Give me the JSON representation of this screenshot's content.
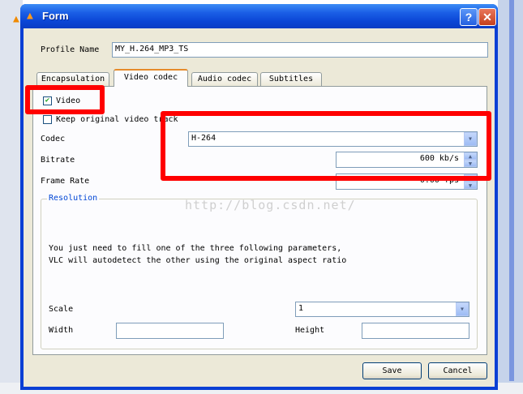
{
  "window": {
    "title": "Form",
    "help_label": "?",
    "close_label": "✕"
  },
  "profile": {
    "label": "Profile Name",
    "value": "MY_H.264_MP3_TS"
  },
  "tabs": [
    {
      "label": "Encapsulation"
    },
    {
      "label": "Video codec"
    },
    {
      "label": "Audio codec"
    },
    {
      "label": "Subtitles"
    }
  ],
  "video_codec": {
    "video_checkbox_label": "Video",
    "keep_original_label": "Keep original video track",
    "codec_label": "Codec",
    "codec_value": "H-264",
    "bitrate_label": "Bitrate",
    "bitrate_value": "600 kb/s",
    "framerate_label": "Frame Rate",
    "framerate_value": "0.00 fps",
    "resolution_title": "Resolution",
    "info_line1": "You just need to fill one of the three following parameters,",
    "info_line2": "VLC will autodetect the other using the original aspect ratio",
    "scale_label": "Scale",
    "scale_value": "1",
    "width_label": "Width",
    "width_value": "",
    "height_label": "Height",
    "height_value": ""
  },
  "buttons": {
    "save": "Save",
    "cancel": "Cancel"
  },
  "watermark": "http://blog.csdn.net/",
  "colors": {
    "titlebar": "#0a3fd4",
    "highlight": "#ff0000",
    "group_title": "#0046d5"
  }
}
